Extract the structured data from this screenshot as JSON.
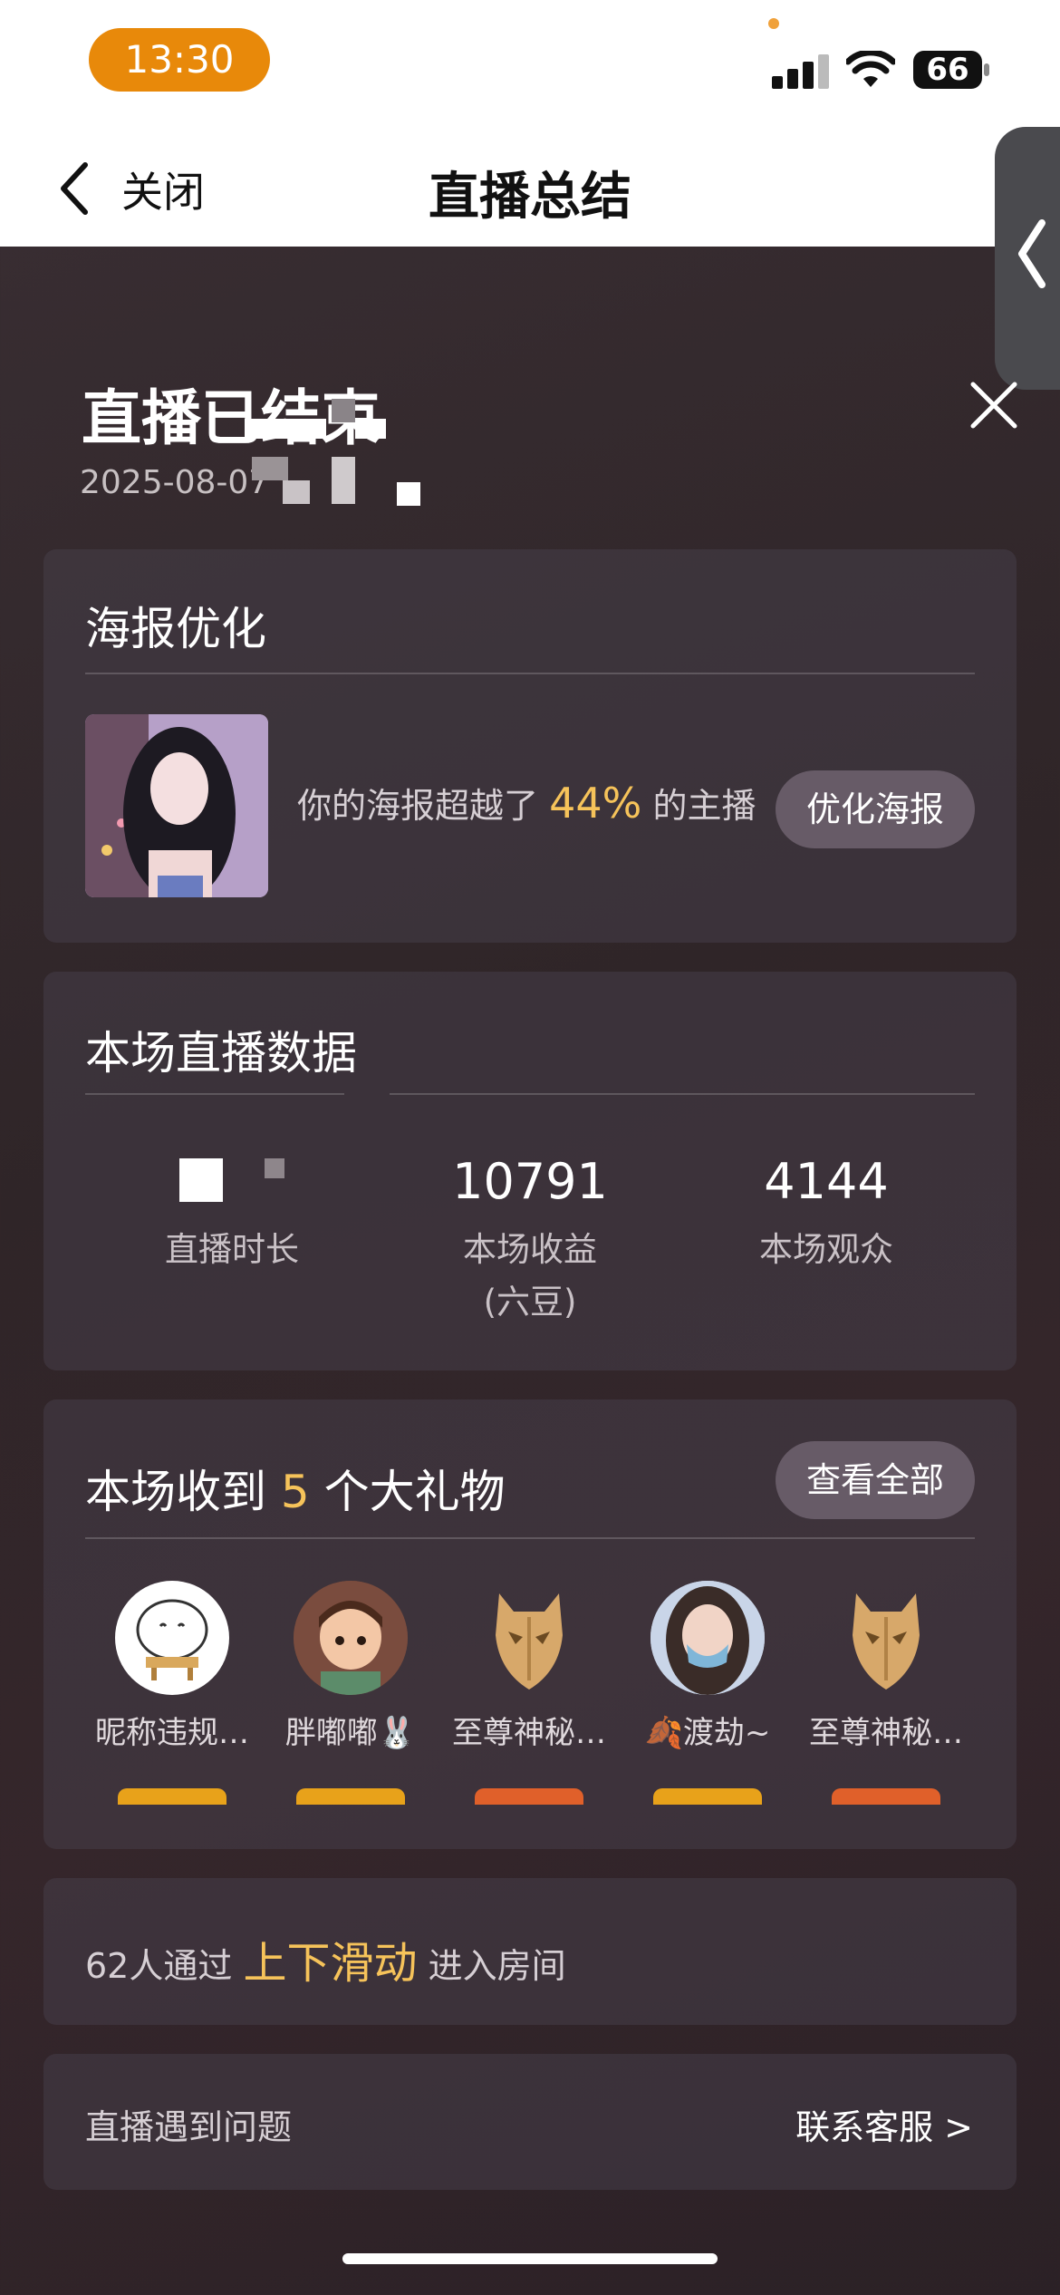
{
  "status_bar": {
    "time": "13:30",
    "battery": "66"
  },
  "nav": {
    "back_label": "关闭",
    "title": "直播总结"
  },
  "header": {
    "ended_title": "直播已结束",
    "date": "2025-08-07"
  },
  "poster": {
    "section_title": "海报优化",
    "text_prefix": "你的海报超越了",
    "percent": "44%",
    "text_suffix": "的主播",
    "button_label": "优化海报"
  },
  "live_data": {
    "section_title": "本场直播数据",
    "stats": [
      {
        "value": "",
        "label": "直播时长"
      },
      {
        "value": "10791",
        "label": "本场收益\n(六豆)"
      },
      {
        "value": "4144",
        "label": "本场观众"
      }
    ]
  },
  "gifts": {
    "title_prefix": "本场收到",
    "count": "5",
    "title_suffix": "个大礼物",
    "view_all_label": "查看全部",
    "users": [
      {
        "name": "昵称违规…",
        "avatar": "sticker-avatar",
        "badge_color": "#e8a21a"
      },
      {
        "name": "胖嘟嘟🐰",
        "avatar": "boy-avatar",
        "badge_color": "#e8a21a"
      },
      {
        "name": "至尊神秘…",
        "avatar": "mystery-mask-icon",
        "badge_color": "#e0602a"
      },
      {
        "name": "🍂渡劫~",
        "avatar": "girl-avatar",
        "badge_color": "#e8a21a"
      },
      {
        "name": "至尊神秘…",
        "avatar": "mystery-mask-icon",
        "badge_color": "#e0602a"
      }
    ]
  },
  "slide": {
    "count_text": "62人通过",
    "highlight": "上下滑动",
    "suffix": "进入房间"
  },
  "support": {
    "problem_label": "直播遇到问题",
    "contact_label": "联系客服 >"
  },
  "colors": {
    "accent": "#f6c35a",
    "status_pill": "#e8890a"
  }
}
